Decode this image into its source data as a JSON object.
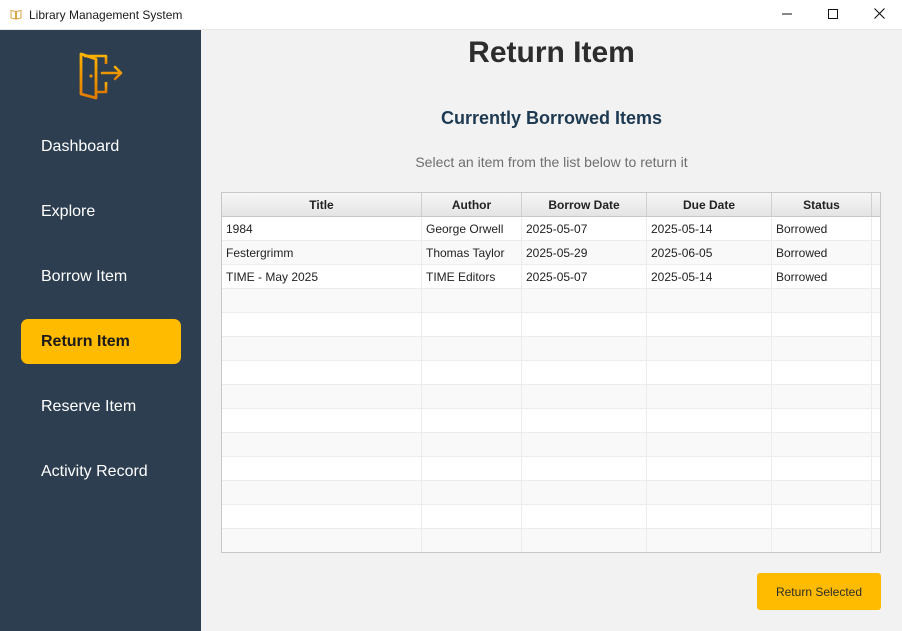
{
  "window": {
    "title": "Library Management System",
    "icons": [
      "book-icon",
      "minimize-icon",
      "maximize-icon",
      "close-icon"
    ]
  },
  "sidebar": {
    "logo_icon": "door-exit-icon",
    "accent_color": "#ffbb00",
    "background_color": "#2c3e50",
    "items": [
      {
        "label": "Dashboard",
        "active": false
      },
      {
        "label": "Explore",
        "active": false
      },
      {
        "label": "Borrow Item",
        "active": false
      },
      {
        "label": "Return Item",
        "active": true
      },
      {
        "label": "Reserve Item",
        "active": false
      },
      {
        "label": "Activity Record",
        "active": false
      }
    ]
  },
  "main": {
    "title": "Return Item",
    "section_title": "Currently Borrowed Items",
    "hint": "Select an item from the list below to return it",
    "table": {
      "columns": [
        "Title",
        "Author",
        "Borrow Date",
        "Due Date",
        "Status"
      ],
      "rows": [
        [
          "1984",
          "George Orwell",
          "2025-05-07",
          "2025-05-14",
          "Borrowed"
        ],
        [
          "Festergrimm",
          "Thomas Taylor",
          "2025-05-29",
          "2025-06-05",
          "Borrowed"
        ],
        [
          "TIME - May 2025",
          "TIME Editors",
          "2025-05-07",
          "2025-05-14",
          "Borrowed"
        ]
      ]
    },
    "return_button": "Return Selected"
  }
}
